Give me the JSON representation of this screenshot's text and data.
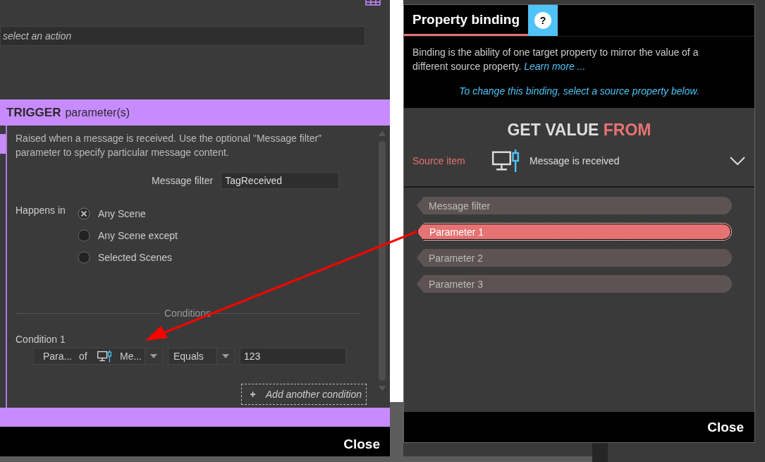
{
  "editor": {
    "action_field": {
      "placeholder": "select an action"
    },
    "trigger_header": {
      "title": "TRIGGER",
      "subtitle": "parameter(s)"
    },
    "description": "Raised when a message is received. Use the optional \"Message filter\" parameter to specify particular message content.",
    "message_filter": {
      "label": "Message filter",
      "value": "TagReceived"
    },
    "happens_in": {
      "label": "Happens in",
      "options": [
        {
          "label": "Any Scene",
          "selected": true
        },
        {
          "label": "Any Scene except",
          "selected": false
        },
        {
          "label": "Selected Scenes",
          "selected": false
        }
      ]
    },
    "conditions_heading": "Conditions",
    "conditions": [
      {
        "label": "Condition 1",
        "parameter": "Para...",
        "connector": "of",
        "source": "Me...",
        "operator": "Equals",
        "value": "123"
      }
    ],
    "add_condition": {
      "icon": "+",
      "label": "Add another condition"
    },
    "close": "Close"
  },
  "binding": {
    "title": "Property binding",
    "help": "?",
    "description": "Binding is the ability of one target property to mirror the value of a different source property.",
    "learn_more": "Learn more ...",
    "hint": "To change this binding, select a source property below.",
    "heading": {
      "main": "GET VALUE",
      "accent": "FROM"
    },
    "source": {
      "label": "Source item",
      "value": "Message is received"
    },
    "properties": [
      {
        "label": "Message filter",
        "selected": false
      },
      {
        "label": "Parameter 1",
        "selected": true
      },
      {
        "label": "Parameter 2",
        "selected": false
      },
      {
        "label": "Parameter 3",
        "selected": false
      }
    ],
    "close": "Close"
  }
}
